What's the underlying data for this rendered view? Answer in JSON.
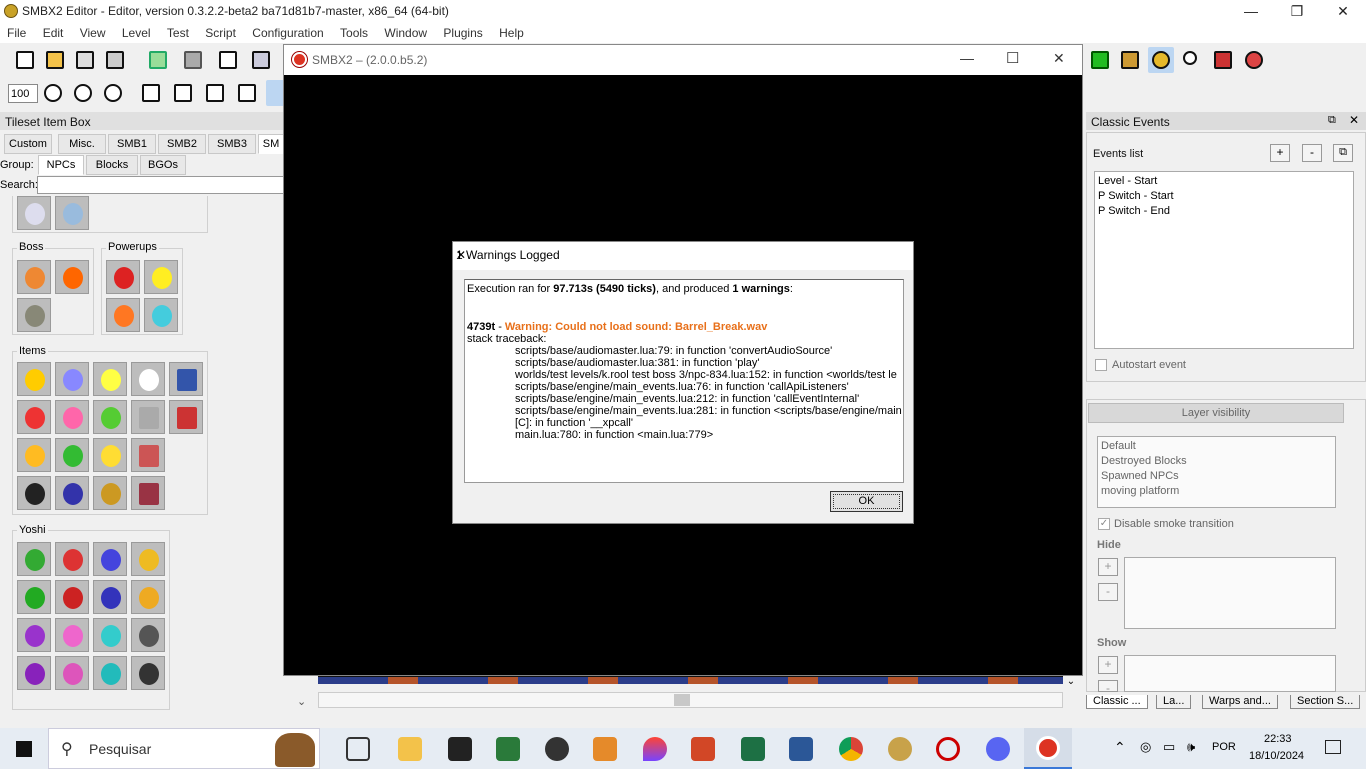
{
  "editor": {
    "title": "SMBX2 Editor - Editor, version 0.3.2.2-beta2 ba71d81b7-master, x86_64 (64-bit)",
    "menu": [
      "File",
      "Edit",
      "View",
      "Level",
      "Test",
      "Script",
      "Configuration",
      "Tools",
      "Window",
      "Plugins",
      "Help"
    ],
    "zoom": "100",
    "window_controls": {
      "minimize": "—",
      "restore": "❐",
      "close": "✕"
    }
  },
  "tileset": {
    "title": "Tileset Item Box",
    "tabs": [
      "Custom",
      "Misc.",
      "SMB1",
      "SMB2",
      "SMB3",
      "SM"
    ],
    "group_label": "Group:",
    "group_tabs": [
      "NPCs",
      "Blocks",
      "BGOs"
    ],
    "search_label": "Search:",
    "search_value": "",
    "sections": {
      "boss": "Boss",
      "powerups": "Powerups",
      "items": "Items",
      "yoshi": "Yoshi"
    }
  },
  "game_window": {
    "title": "SMBX2 – (2.0.0.b5.2)",
    "controls": {
      "minimize": "—",
      "maximize": "☐",
      "close": "✕"
    }
  },
  "dialog": {
    "title": "1 Warnings Logged",
    "close": "✕",
    "summary_prefix": "Execution ran for ",
    "summary_time": "97.713s (5490 ticks)",
    "summary_mid": ", and produced ",
    "summary_count": "1 warnings",
    "summary_end": ":",
    "tick": "4739t",
    "tick_sep": " - ",
    "warning": "Warning: Could not load sound: Barrel_Break.wav",
    "traceback_label": "stack traceback:",
    "traceback": [
      "scripts/base/audiomaster.lua:79: in function 'convertAudioSource'",
      "scripts/base/audiomaster.lua:381: in function 'play'",
      "worlds/test levels/k.rool test boss 3/npc-834.lua:152: in function <worlds/test le",
      "scripts/base/engine/main_events.lua:76: in function 'callApiListeners'",
      "scripts/base/engine/main_events.lua:212: in function 'callEventInternal'",
      "scripts/base/engine/main_events.lua:281: in function <scripts/base/engine/main",
      "[C]: in function '__xpcall'",
      "main.lua:780: in function <main.lua:779>"
    ],
    "ok_label": "OK",
    "warning_color": "#e8701a"
  },
  "classic_events": {
    "title": "Classic Events",
    "events_list_label": "Events list",
    "add": "+",
    "remove": "-",
    "events": [
      "Level - Start",
      "P Switch - Start",
      "P Switch - End"
    ],
    "autostart_label": "Autostart event",
    "layer_visibility_label": "Layer visibility",
    "layers": [
      "Default",
      "Destroyed Blocks",
      "Spawned NPCs",
      "moving platform"
    ],
    "disable_smoke_label": "Disable smoke transition",
    "hide_label": "Hide",
    "show_label": "Show",
    "bottom_tabs": [
      "Classic ...",
      "La...",
      "Warps and...",
      "Section S..."
    ]
  },
  "taskbar": {
    "search_placeholder": "Pesquisar",
    "language": "POR",
    "time": "22:33",
    "date": "18/10/2024"
  }
}
